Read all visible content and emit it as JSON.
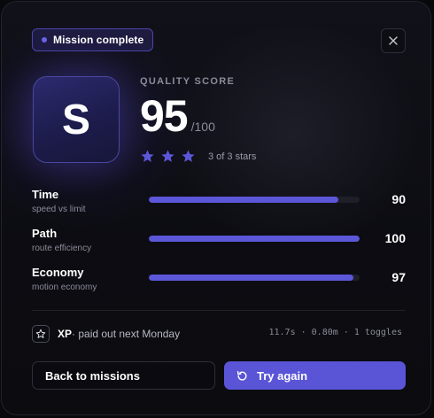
{
  "badge": {
    "label": "Mission complete"
  },
  "grade": {
    "letter": "S"
  },
  "quality": {
    "label": "QUALITY SCORE",
    "score": "95",
    "max": "/100",
    "stars_filled": 3,
    "stars_total": 3,
    "stars_text": "3 of 3 stars"
  },
  "metrics": [
    {
      "name": "Time",
      "sub": "speed vs limit",
      "value": "90",
      "fraction": 0.9
    },
    {
      "name": "Path",
      "sub": "route efficiency",
      "value": "100",
      "fraction": 1.0
    },
    {
      "name": "Economy",
      "sub": "motion economy",
      "value": "97",
      "fraction": 0.97
    }
  ],
  "xp": {
    "label": "XP",
    "note": " · paid out next Monday"
  },
  "stats": {
    "text": "11.7s · 0.80m · 1 toggles"
  },
  "actions": {
    "back_label": "Back to missions",
    "retry_label": "Try again"
  },
  "colors": {
    "accent": "#5a55d6",
    "bar_fill": "#5b57d8",
    "badge_dot": "#6b63e6"
  },
  "icons": {
    "close": "close-icon",
    "star": "star-icon",
    "xp": "star-outline-icon",
    "retry": "refresh-icon"
  }
}
